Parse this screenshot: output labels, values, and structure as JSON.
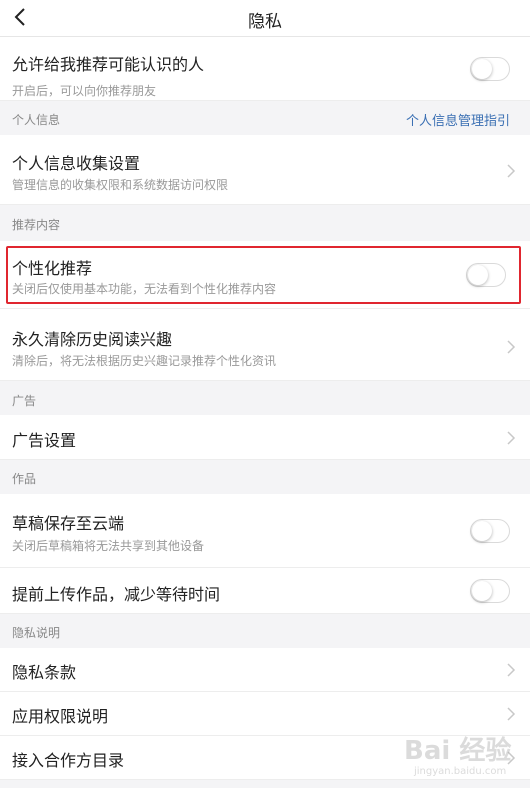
{
  "nav": {
    "title": "隐私",
    "back_icon": "chevron-left-icon"
  },
  "rows": {
    "recommend_people": {
      "title": "允许给我推荐可能认识的人",
      "subtitle": "开启后，可以向你推荐朋友",
      "toggle_on": false
    },
    "personal_collect": {
      "title": "个人信息收集设置",
      "subtitle": "管理信息的收集权限和系统数据访问权限"
    },
    "personalized": {
      "title": "个性化推荐",
      "subtitle": "关闭后仅使用基本功能，无法看到个性化推荐内容",
      "toggle_on": false
    },
    "clear_history": {
      "title": "永久清除历史阅读兴趣",
      "subtitle": "清除后，将无法根据历史兴趣记录推荐个性化资讯"
    },
    "ad_settings": {
      "title": "广告设置"
    },
    "draft_cloud": {
      "title": "草稿保存至云端",
      "subtitle": "关闭后草稿箱将无法共享到其他设备",
      "toggle_on": false
    },
    "upload_early": {
      "title": "提前上传作品，减少等待时间",
      "toggle_on": false
    },
    "privacy_terms": {
      "title": "隐私条款"
    },
    "app_permissions": {
      "title": "应用权限说明"
    },
    "partner_list": {
      "title": "接入合作方目录"
    }
  },
  "sections": {
    "personal_info": {
      "header": "个人信息",
      "link": "个人信息管理指引"
    },
    "recommend": {
      "header": "推荐内容"
    },
    "ads": {
      "header": "广告"
    },
    "works": {
      "header": "作品"
    },
    "privacy_note": {
      "header": "隐私说明"
    }
  },
  "watermark": {
    "text": "Bai 经验",
    "url": "jingyan.baidu.com"
  },
  "colors": {
    "link": "#3a6fb3",
    "highlight": "#e0262f"
  }
}
